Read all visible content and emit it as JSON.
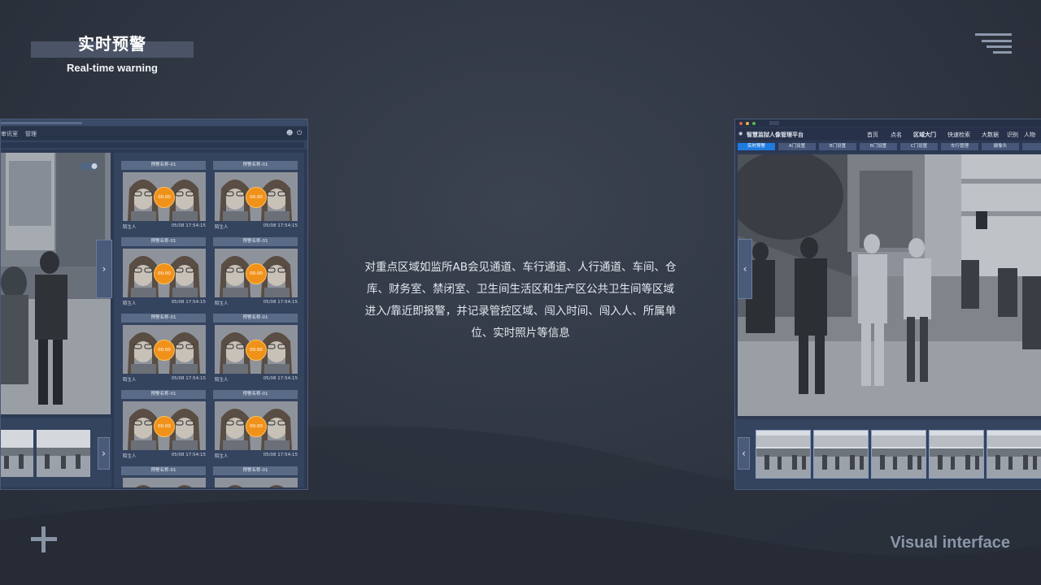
{
  "header": {
    "title_cn": "实时预警",
    "title_en": "Real-time warning"
  },
  "description": "对重点区域如监所AB会见通道、车行通道、人行通道、车间、仓库、财务室、禁闭室、卫生间生活区和生产区公共卫生间等区域进入/靠近即报警，并记录管控区域、闯入时间、闯入人、所属单位、实时照片等信息",
  "footer_label": "Visual interface",
  "left_window": {
    "nav": [
      "审讯室",
      "管理"
    ],
    "cards": [
      {
        "title": "预警名称-01",
        "name": "陌生人",
        "time": "05/08  17:54:15",
        "score": "00.00"
      },
      {
        "title": "预警名称-01",
        "name": "陌生人",
        "time": "05/08  17:54:15",
        "score": "00.00"
      },
      {
        "title": "预警名称-01",
        "name": "陌生人",
        "time": "05/08  17:54:15",
        "score": "00.00"
      },
      {
        "title": "预警名称-01",
        "name": "陌生人",
        "time": "05/08  17:54:15",
        "score": "00.00"
      },
      {
        "title": "预警名称-01",
        "name": "陌生人",
        "time": "05/08  17:54:15",
        "score": "00.00"
      },
      {
        "title": "预警名称-01",
        "name": "陌生人",
        "time": "05/08  17:54:15",
        "score": "00.00"
      },
      {
        "title": "预警名称-01",
        "name": "陌生人",
        "time": "05/08  17:54:15",
        "score": "00.00"
      },
      {
        "title": "预警名称-01",
        "name": "陌生人",
        "time": "05/08  17:54:15",
        "score": "00.00"
      },
      {
        "title": "预警名称-01",
        "name": "",
        "time": "",
        "score": ""
      },
      {
        "title": "预警名称-01",
        "name": "",
        "time": "",
        "score": ""
      }
    ]
  },
  "right_window": {
    "app_title": "智慧监狱人像管理平台",
    "nav": [
      "首页",
      "点名",
      "区域大门",
      "快速检索",
      "大数据",
      "识别",
      "人物"
    ],
    "tabs": [
      "实时预警",
      "A门设置",
      "B门设置",
      "B门设置",
      "C门设置",
      "车行管理",
      "摄像头"
    ]
  },
  "colors": {
    "accent": "#1e7be0",
    "badge": "#f0921a",
    "background": "#2f3541",
    "panel": "#34435e"
  }
}
